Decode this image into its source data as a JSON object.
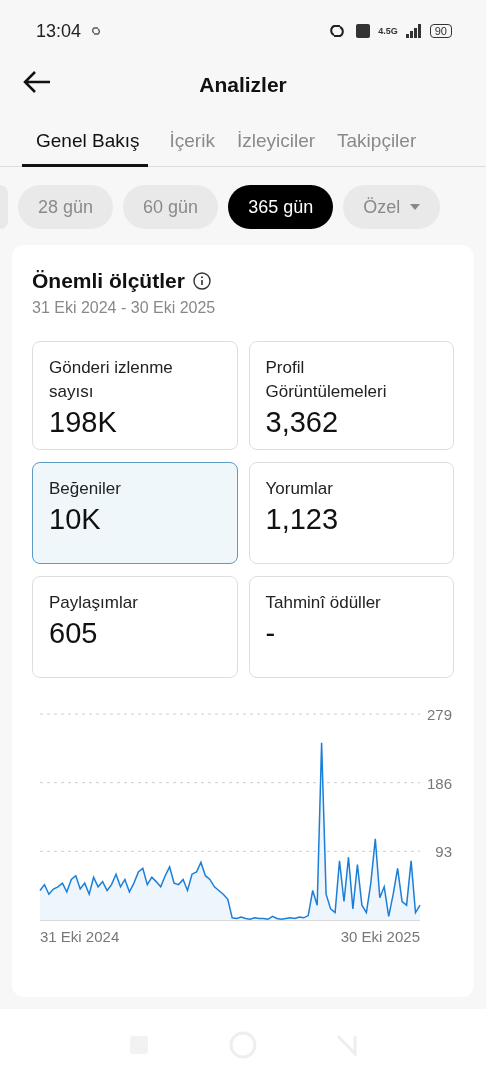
{
  "status_bar": {
    "time": "13:04",
    "network": "4.5G",
    "battery": "90"
  },
  "header": {
    "title": "Analizler"
  },
  "tabs": [
    {
      "label": "Genel Bakış",
      "selected": true
    },
    {
      "label": "İçerik",
      "selected": false
    },
    {
      "label": "İzleyiciler",
      "selected": false
    },
    {
      "label": "Takipçiler",
      "selected": false
    }
  ],
  "ranges": [
    {
      "label": "28 gün",
      "selected": false,
      "kind": "chip"
    },
    {
      "label": "60 gün",
      "selected": false,
      "kind": "chip"
    },
    {
      "label": "365 gün",
      "selected": true,
      "kind": "chip"
    },
    {
      "label": "Özel",
      "selected": false,
      "kind": "dropdown"
    }
  ],
  "metrics_panel": {
    "title": "Önemli ölçütler",
    "date_range": "31 Eki 2024 - 30 Eki 2025",
    "metrics": [
      {
        "label": "Gönderi izlenme sayısı",
        "value": "198K",
        "selected": false
      },
      {
        "label": "Profil Görüntülemeleri",
        "value": "3,362",
        "selected": false
      },
      {
        "label": "Beğeniler",
        "value": "10K",
        "selected": true
      },
      {
        "label": "Yorumlar",
        "value": "1,123",
        "selected": false
      },
      {
        "label": "Paylaşımlar",
        "value": "605",
        "selected": false
      },
      {
        "label": "Tahminî ödüller",
        "value": "-",
        "selected": false
      }
    ],
    "chart_start": "31 Eki 2024",
    "chart_end": "30 Eki 2025",
    "chart_data": {
      "type": "area",
      "series": [
        {
          "color": "#1a7fd9",
          "values": [
            40,
            48,
            35,
            42,
            45,
            50,
            38,
            55,
            60,
            42,
            50,
            35,
            58,
            45,
            52,
            40,
            48,
            62,
            45,
            55,
            38,
            50,
            65,
            70,
            48,
            58,
            52,
            45,
            60,
            72,
            50,
            48,
            55,
            40,
            62,
            65,
            78,
            60,
            55,
            45,
            40,
            35,
            28,
            3,
            2,
            4,
            2,
            1,
            3,
            2,
            2,
            1,
            5,
            2,
            1,
            2,
            3,
            2,
            4,
            3,
            6,
            40,
            20,
            240,
            35,
            15,
            10,
            80,
            25,
            85,
            15,
            75,
            20,
            10,
            50,
            110,
            30,
            45,
            5,
            35,
            70,
            25,
            20,
            80,
            10,
            20
          ]
        }
      ],
      "ylim": [
        0,
        279
      ],
      "yticks": [
        93,
        186,
        279
      ]
    }
  }
}
